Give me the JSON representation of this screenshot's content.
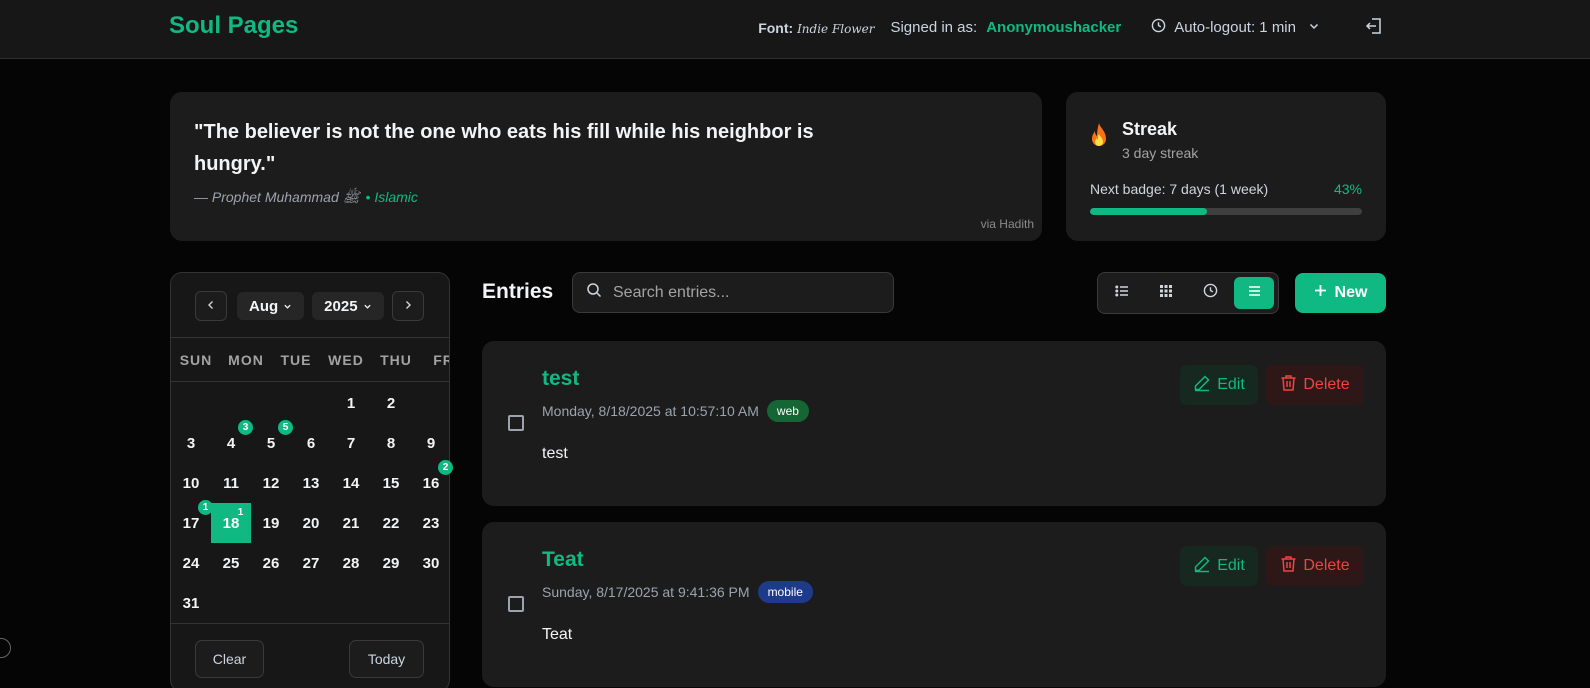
{
  "header": {
    "brand": "Soul Pages",
    "font_label": "Font:",
    "font_value": "Indie Flower",
    "signed_in_label": "Signed in as:",
    "username": "Anonymoushacker",
    "auto_logout": "Auto-logout: 1 min"
  },
  "quote": {
    "text": "\"The believer is not the one who eats his fill while his neighbor is hungry.\"",
    "author": "— Prophet Muhammad ﷺ",
    "category": "• Islamic",
    "source": "via Hadith"
  },
  "streak": {
    "title": "Streak",
    "subtitle": "3 day streak",
    "next_badge": "Next badge: 7 days (1 week)",
    "percent_label": "43%",
    "progress": 0.43
  },
  "calendar": {
    "month": "Aug",
    "year": "2025",
    "weekdays": [
      "SUN",
      "MON",
      "TUE",
      "WED",
      "THU",
      "FRI"
    ],
    "days": [
      {
        "d": "1",
        "col": 4,
        "row": 0
      },
      {
        "d": "2",
        "col": 5,
        "row": 0
      },
      {
        "d": "3",
        "col": 0,
        "row": 1
      },
      {
        "d": "4",
        "col": 1,
        "row": 1,
        "count": "3"
      },
      {
        "d": "5",
        "col": 2,
        "row": 1,
        "count": "5"
      },
      {
        "d": "6",
        "col": 3,
        "row": 1
      },
      {
        "d": "7",
        "col": 4,
        "row": 1
      },
      {
        "d": "8",
        "col": 5,
        "row": 1
      },
      {
        "d": "9",
        "col": 6,
        "row": 1
      },
      {
        "d": "10",
        "col": 0,
        "row": 2
      },
      {
        "d": "11",
        "col": 1,
        "row": 2
      },
      {
        "d": "12",
        "col": 2,
        "row": 2
      },
      {
        "d": "13",
        "col": 3,
        "row": 2
      },
      {
        "d": "14",
        "col": 4,
        "row": 2
      },
      {
        "d": "15",
        "col": 5,
        "row": 2
      },
      {
        "d": "16",
        "col": 6,
        "row": 2,
        "count": "2"
      },
      {
        "d": "17",
        "col": 0,
        "row": 3,
        "count": "1"
      },
      {
        "d": "18",
        "col": 1,
        "row": 3,
        "count": "1",
        "selected": true
      },
      {
        "d": "19",
        "col": 2,
        "row": 3
      },
      {
        "d": "20",
        "col": 3,
        "row": 3
      },
      {
        "d": "21",
        "col": 4,
        "row": 3
      },
      {
        "d": "22",
        "col": 5,
        "row": 3
      },
      {
        "d": "23",
        "col": 6,
        "row": 3
      },
      {
        "d": "24",
        "col": 0,
        "row": 4
      },
      {
        "d": "25",
        "col": 1,
        "row": 4
      },
      {
        "d": "26",
        "col": 2,
        "row": 4
      },
      {
        "d": "27",
        "col": 3,
        "row": 4
      },
      {
        "d": "28",
        "col": 4,
        "row": 4
      },
      {
        "d": "29",
        "col": 5,
        "row": 4
      },
      {
        "d": "30",
        "col": 6,
        "row": 4
      },
      {
        "d": "31",
        "col": 0,
        "row": 5
      }
    ],
    "clear_label": "Clear",
    "today_label": "Today"
  },
  "entries_section": {
    "title": "Entries",
    "search_placeholder": "Search entries...",
    "new_label": "New",
    "view_icons": [
      "list-icon",
      "grid-icon",
      "clock-icon",
      "lines-icon"
    ],
    "active_view": "lines-icon"
  },
  "entries": [
    {
      "title": "test",
      "date": "Monday, 8/18/2025 at 10:57:10 AM",
      "tag": "web",
      "tag_color": "#166534",
      "body": "test",
      "edit_label": "Edit",
      "delete_label": "Delete"
    },
    {
      "title": "Teat",
      "date": "Sunday, 8/17/2025 at 9:41:36 PM",
      "tag": "mobile",
      "tag_color": "#1e3a8a",
      "body": "Teat",
      "edit_label": "Edit",
      "delete_label": "Delete"
    }
  ],
  "colors": {
    "accent": "#10b981",
    "danger": "#ef4444",
    "background": "#050505",
    "card": "#1c1c1c"
  }
}
